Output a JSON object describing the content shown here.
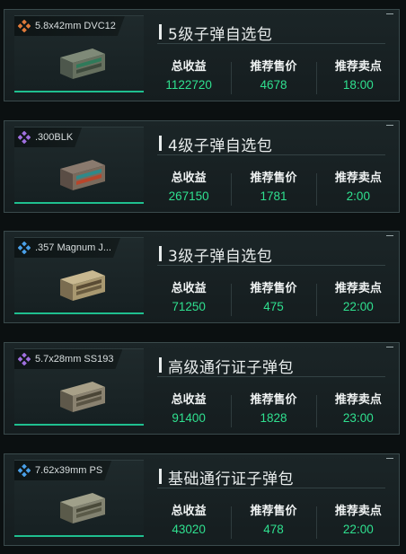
{
  "labels": {
    "income": "总收益",
    "price": "推荐售价",
    "sell_point": "推荐卖点"
  },
  "colors": {
    "accent_green": "#2fe08f",
    "tier5_icon": "#e07a3a",
    "tier4_icon": "#a070e0",
    "tier3_icon": "#4aa0e8",
    "tier2_icon": "#a070e0",
    "tier1_icon": "#4aa0e8"
  },
  "packs": [
    {
      "title": "5级子弹自选包",
      "ammo": "5.8x42mm DVC12",
      "icon": "orange-diamond-icon",
      "total_income": "1122720",
      "suggested_price": "4678",
      "sell_time": "18:00"
    },
    {
      "title": "4级子弹自选包",
      "ammo": ".300BLK",
      "icon": "purple-diamond-icon",
      "total_income": "267150",
      "suggested_price": "1781",
      "sell_time": "2:00"
    },
    {
      "title": "3级子弹自选包",
      "ammo": ".357 Magnum J...",
      "icon": "blue-diamond-icon",
      "total_income": "71250",
      "suggested_price": "475",
      "sell_time": "22:00"
    },
    {
      "title": "高级通行证子弹包",
      "ammo": "5.7x28mm SS193",
      "icon": "purple-diamond-icon",
      "total_income": "91400",
      "suggested_price": "1828",
      "sell_time": "23:00"
    },
    {
      "title": "基础通行证子弹包",
      "ammo": "7.62x39mm PS",
      "icon": "blue-diamond-icon",
      "total_income": "43020",
      "suggested_price": "478",
      "sell_time": "22:00"
    }
  ]
}
